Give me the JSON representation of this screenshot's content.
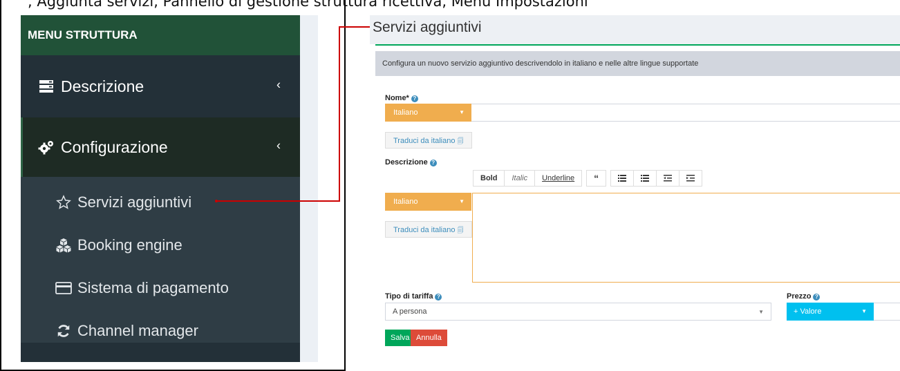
{
  "top_caption": ", Aggiunta servizi, Pannello di gestione struttura ricettiva, Menu Impostazioni",
  "sidebar": {
    "header": "MENU STRUTTURA",
    "items": [
      {
        "label": "Descrizione",
        "icon": "server-icon"
      },
      {
        "label": "Configurazione",
        "icon": "cogs-icon"
      }
    ],
    "sub_items": [
      {
        "label": "Servizi aggiuntivi",
        "icon": "star-outline-icon"
      },
      {
        "label": "Booking engine",
        "icon": "cubes-icon"
      },
      {
        "label": "Sistema di pagamento",
        "icon": "credit-card-icon"
      },
      {
        "label": "Channel manager",
        "icon": "refresh-icon"
      }
    ]
  },
  "page": {
    "title": "Servizi aggiuntivi",
    "info": "Configura un nuovo servizio aggiuntivo descrivendolo in italiano e nelle altre lingue supportate",
    "name_label": "Nome*",
    "lang_selected": "Italiano",
    "translate_label": "Traduci da italiano",
    "description_label": "Descrizione",
    "toolbar": {
      "bold": "Bold",
      "italic": "Italic",
      "underline": "Underline"
    },
    "rate_label": "Tipo di tariffa",
    "rate_value": "A persona",
    "price_label": "Prezzo",
    "price_button": "+ Valore",
    "save": "Salva",
    "cancel": "Annulla"
  },
  "colors": {
    "sidebar_bg": "#2b3a42",
    "header_green": "#215238",
    "language_orange": "#f0ad4e",
    "save_green": "#00a65a",
    "cancel_red": "#dd4b39",
    "price_blue": "#00c0ef",
    "arrow_red": "#cc0000"
  }
}
